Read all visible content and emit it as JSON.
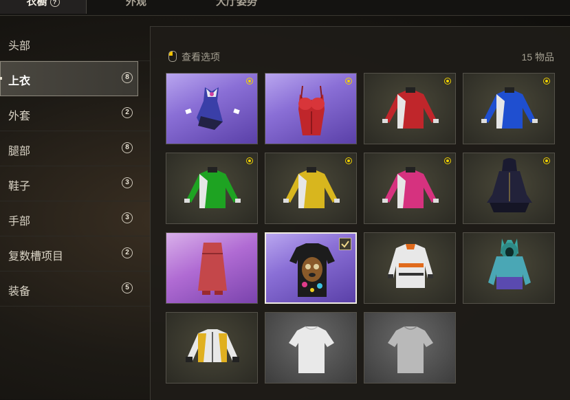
{
  "top_tabs": [
    {
      "label": "衣橱"
    },
    {
      "label": "外观"
    },
    {
      "label": "大厅姿势"
    }
  ],
  "sidebar": {
    "items": [
      {
        "label": "头部",
        "count": ""
      },
      {
        "label": "上衣",
        "count": "8",
        "active": true
      },
      {
        "label": "外套",
        "count": "2"
      },
      {
        "label": "腿部",
        "count": "8"
      },
      {
        "label": "鞋子",
        "count": "3"
      },
      {
        "label": "手部",
        "count": "3"
      },
      {
        "label": "复数槽项目",
        "count": "2"
      },
      {
        "label": "装备",
        "count": "5"
      }
    ]
  },
  "main": {
    "view_options_label": "查看选项",
    "item_count": "15 物品",
    "items": [
      {
        "name": "purple-dress-outfit",
        "equipped": true
      },
      {
        "name": "red-corset-top",
        "equipped": true
      },
      {
        "name": "red-long-sleeve-shirt",
        "equipped": true
      },
      {
        "name": "blue-long-sleeve-shirt",
        "equipped": true
      },
      {
        "name": "green-long-sleeve-shirt",
        "equipped": true
      },
      {
        "name": "yellow-long-sleeve-shirt",
        "equipped": true
      },
      {
        "name": "pink-long-sleeve-shirt",
        "equipped": true
      },
      {
        "name": "dark-hooded-dress",
        "equipped": true
      },
      {
        "name": "red-knit-dress",
        "equipped": false
      },
      {
        "name": "dog-print-tshirt",
        "equipped": false,
        "selected": true
      },
      {
        "name": "orange-white-jacket",
        "equipped": false
      },
      {
        "name": "teal-bunny-hoodie",
        "equipped": false
      },
      {
        "name": "yellow-white-jacket",
        "equipped": false
      },
      {
        "name": "white-tshirt",
        "equipped": false
      },
      {
        "name": "grey-tshirt",
        "equipped": false
      }
    ]
  },
  "colors": {
    "accent_yellow": "#f2d200",
    "shirt_red": "#c0262b",
    "shirt_blue": "#1f4fd0",
    "shirt_green": "#1ea322",
    "shirt_yellow": "#d8b61e",
    "shirt_pink": "#d6327f"
  }
}
